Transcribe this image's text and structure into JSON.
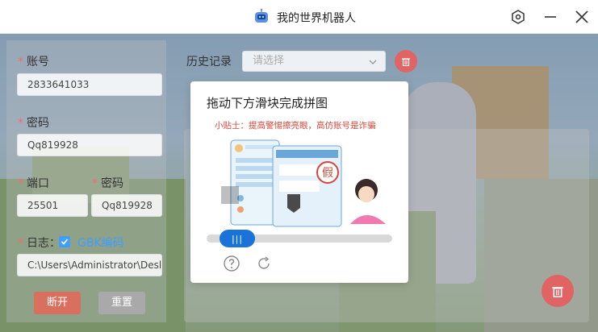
{
  "window": {
    "title": "我的世界机器人"
  },
  "form": {
    "account_label": "账号",
    "account_value": "2833641033",
    "password_label": "密码",
    "password_value": "Qq819928",
    "port_label": "端口",
    "port_value": "25501",
    "password2_label": "密码",
    "password2_value": "Qq819928",
    "log_label": "日志：",
    "log_checked": true,
    "encoding_link": "GBK编码",
    "path_value": "C:\\Users\\Administrator\\Desl",
    "disconnect_label": "断开",
    "reconnect_label": "重置"
  },
  "history": {
    "label": "历史记录",
    "select_placeholder": "请选择"
  },
  "captcha": {
    "title": "拖动下方滑块完成拼图",
    "banner": "小贴士：提高警惕擦亮眼，高仿账号是诈骗",
    "stamp": "假",
    "slider_progress": 0.09,
    "thumb_glyph": "|||"
  },
  "colors": {
    "accent": "#409eff",
    "danger": "#e06464",
    "slider": "#1a73d9",
    "required": "#f56c6c"
  },
  "icons": {
    "app": "robot-icon",
    "settings": "settings-icon",
    "minimize": "minimize-icon",
    "close": "close-icon",
    "delete": "trash-icon",
    "help": "question-circle-icon",
    "refresh": "refresh-icon",
    "dropdown": "chevron-down-icon"
  }
}
